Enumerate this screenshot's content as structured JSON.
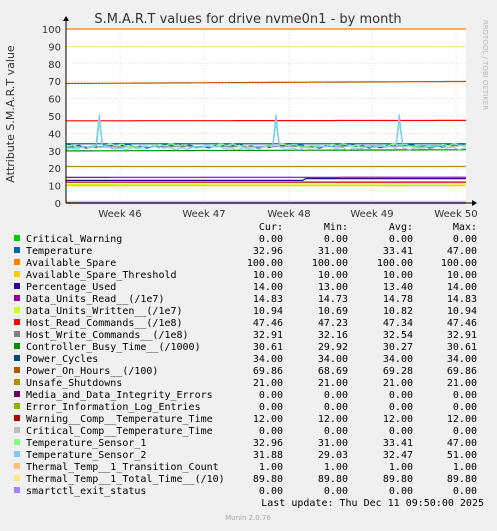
{
  "chart_data": {
    "type": "line",
    "title": "S.M.A.R.T values for drive nvme0n1 - by month",
    "ylabel": "Attribute S.M.A.R.T value",
    "xlabel": "",
    "ylim": [
      0,
      100
    ],
    "yticks": [
      0,
      10,
      20,
      30,
      40,
      50,
      60,
      70,
      80,
      90,
      100
    ],
    "xticks": [
      "Week 46",
      "Week 47",
      "Week 48",
      "Week 49",
      "Week 50"
    ],
    "grid": true,
    "legend_placement": "bottom",
    "columns": [
      "Cur:",
      "Min:",
      "Avg:",
      "Max:"
    ],
    "series": [
      {
        "name": "Critical_Warning",
        "color": "#00cc00",
        "cur": "0.00",
        "min": "0.00",
        "avg": "0.00",
        "max": "0.00"
      },
      {
        "name": "Temperature",
        "color": "#0066b3",
        "cur": "32.96",
        "min": "31.00",
        "avg": "33.41",
        "max": "47.00"
      },
      {
        "name": "Available_Spare",
        "color": "#ff8000",
        "cur": "100.00",
        "min": "100.00",
        "avg": "100.00",
        "max": "100.00"
      },
      {
        "name": "Available_Spare_Threshold",
        "color": "#ffcc00",
        "cur": "10.00",
        "min": "10.00",
        "avg": "10.00",
        "max": "10.00"
      },
      {
        "name": "Percentage_Used",
        "color": "#330099",
        "cur": "14.00",
        "min": "13.00",
        "avg": "13.40",
        "max": "14.00"
      },
      {
        "name": "Data_Units_Read__(/1e7)",
        "color": "#990099",
        "cur": "14.83",
        "min": "14.73",
        "avg": "14.78",
        "max": "14.83"
      },
      {
        "name": "Data_Units_Written__(/1e7)",
        "color": "#ccff00",
        "cur": "10.94",
        "min": "10.69",
        "avg": "10.82",
        "max": "10.94"
      },
      {
        "name": "Host_Read_Commands__(/1e8)",
        "color": "#ff0000",
        "cur": "47.46",
        "min": "47.23",
        "avg": "47.34",
        "max": "47.46"
      },
      {
        "name": "Host_Write_Commands__(/1e8)",
        "color": "#808080",
        "cur": "32.91",
        "min": "32.16",
        "avg": "32.54",
        "max": "32.91"
      },
      {
        "name": "Controller_Busy_Time__(/1000)",
        "color": "#008f00",
        "cur": "30.61",
        "min": "29.92",
        "avg": "30.27",
        "max": "30.61"
      },
      {
        "name": "Power_Cycles",
        "color": "#00487d",
        "cur": "34.00",
        "min": "34.00",
        "avg": "34.00",
        "max": "34.00"
      },
      {
        "name": "Power_On_Hours__(/100)",
        "color": "#b35a00",
        "cur": "69.86",
        "min": "68.69",
        "avg": "69.28",
        "max": "69.86"
      },
      {
        "name": "Unsafe_Shutdowns",
        "color": "#b38f00",
        "cur": "21.00",
        "min": "21.00",
        "avg": "21.00",
        "max": "21.00"
      },
      {
        "name": "Media_and_Data_Integrity_Errors",
        "color": "#6b006b",
        "cur": "0.00",
        "min": "0.00",
        "avg": "0.00",
        "max": "0.00"
      },
      {
        "name": "Error_Information_Log_Entries",
        "color": "#8fb300",
        "cur": "0.00",
        "min": "0.00",
        "avg": "0.00",
        "max": "0.00"
      },
      {
        "name": "Warning__Comp__Temperature_Time",
        "color": "#b30000",
        "cur": "12.00",
        "min": "12.00",
        "avg": "12.00",
        "max": "12.00"
      },
      {
        "name": "Critical_Comp__Temperature_Time",
        "color": "#bebebe",
        "cur": "0.00",
        "min": "0.00",
        "avg": "0.00",
        "max": "0.00"
      },
      {
        "name": "Temperature_Sensor_1",
        "color": "#80ff80",
        "cur": "32.96",
        "min": "31.00",
        "avg": "33.41",
        "max": "47.00"
      },
      {
        "name": "Temperature_Sensor_2",
        "color": "#80c9ff",
        "cur": "31.88",
        "min": "29.03",
        "avg": "32.47",
        "max": "51.00"
      },
      {
        "name": "Thermal_Temp__1_Transition_Count",
        "color": "#ffc080",
        "cur": "1.00",
        "min": "1.00",
        "avg": "1.00",
        "max": "1.00"
      },
      {
        "name": "Thermal_Temp__1_Total_Time__(/10)",
        "color": "#ffe680",
        "cur": "89.80",
        "min": "89.80",
        "avg": "89.80",
        "max": "89.80"
      },
      {
        "name": "smartctl_exit_status",
        "color": "#aa80ff",
        "cur": "0.00",
        "min": "0.00",
        "avg": "0.00",
        "max": "0.00"
      }
    ],
    "last_update": "Last update: Thu Dec 11 09:50:00 2025",
    "footer": "Munin 2.0.76",
    "watermark": "RRDTOOL / TOBI OETIKER"
  }
}
